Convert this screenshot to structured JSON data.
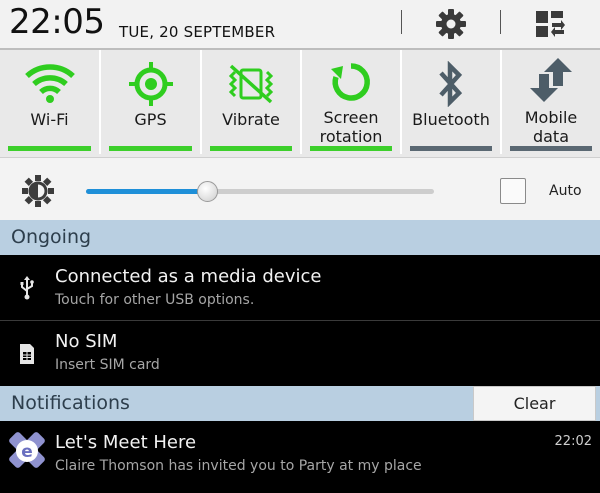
{
  "header": {
    "time": "22:05",
    "date": "TUE, 20 SEPTEMBER",
    "settings_icon": "gear-icon",
    "edit_icon": "grid-toggle-icon"
  },
  "quick_settings": [
    {
      "label": "Wi-Fi",
      "icon": "wifi-icon",
      "state": "on"
    },
    {
      "label": "GPS",
      "icon": "gps-icon",
      "state": "on"
    },
    {
      "label": "Vibrate",
      "icon": "vibrate-icon",
      "state": "on"
    },
    {
      "label": "Screen\nrotation",
      "icon": "rotation-icon",
      "state": "on"
    },
    {
      "label": "Bluetooth",
      "icon": "bluetooth-icon",
      "state": "off"
    },
    {
      "label": "Mobile\ndata",
      "icon": "mobile-data-icon",
      "state": "off"
    }
  ],
  "brightness": {
    "icon": "brightness-icon",
    "level": 0.35,
    "auto_label": "Auto",
    "auto_checked": false
  },
  "ongoing": {
    "title": "Ongoing",
    "items": [
      {
        "icon": "usb-icon",
        "title": "Connected as a media device",
        "subtitle": "Touch for other USB options."
      },
      {
        "icon": "sim-card-icon",
        "title": "No SIM",
        "subtitle": "Insert SIM card"
      }
    ]
  },
  "notifications": {
    "title": "Notifications",
    "clear_label": "Clear",
    "items": [
      {
        "icon": "app-e-icon",
        "title": "Let's Meet Here",
        "subtitle": "Claire Thomson has invited you to Party at my place",
        "time": "22:02"
      }
    ]
  },
  "colors": {
    "accent_on": "#3ccf2b",
    "accent_off": "#5a6872",
    "slider": "#1e8fd8",
    "section_bg": "#b9cfe1"
  }
}
